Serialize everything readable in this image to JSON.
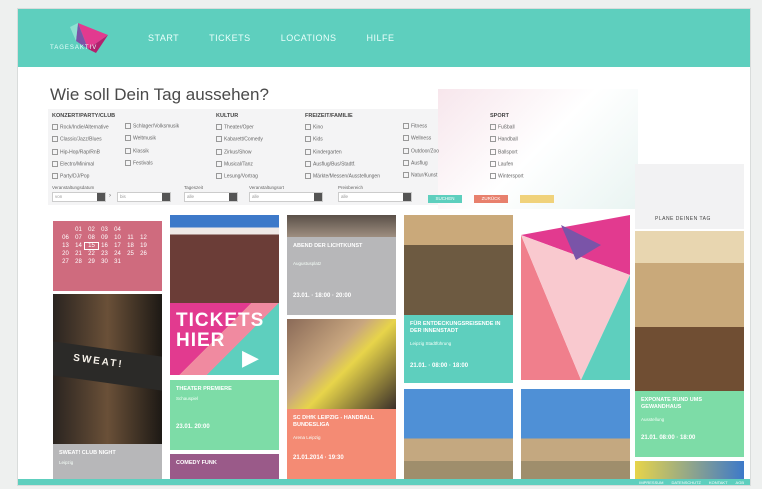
{
  "nav": {
    "items": [
      "START",
      "TICKETS",
      "LOCATIONS",
      "HILFE"
    ]
  },
  "logo": {
    "text": "TAGESAKTIV"
  },
  "headline": "Wie soll Dein Tag aussehen?",
  "filters": [
    {
      "heading": "KONZERT/PARTY/CLUB",
      "items": [
        "Rock/Indie/Alternative",
        "Classic/Jazz/Blues",
        "Hip-Hop/Rap/RnB",
        "Electro/Minimal",
        "Party/DJ/Pop"
      ],
      "col2": [
        "Schlager/Volksmusik",
        "Weltmusik",
        "Klassik",
        "Festivals"
      ]
    },
    {
      "heading": "KULTUR",
      "items": [
        "Theater/Oper",
        "Kabarett/Comedy",
        "Zirkus/Show",
        "Musical/Tanz",
        "Lesung/Vortrag"
      ]
    },
    {
      "heading": "FREIZEIT/FAMILIE",
      "items": [
        "Kino",
        "Kids",
        "Kindergarten",
        "Ausflug/Bus/Stadtf.",
        "Märkte/Messen/Ausstellungen"
      ]
    },
    {
      "heading": "",
      "items": [
        "Fitness",
        "Wellness",
        "Outdoor/Zoo",
        "Ausflug",
        "Natur/Kunst"
      ]
    },
    {
      "heading": "SPORT",
      "items": [
        "Fußball",
        "Handball",
        "Ballsport",
        "Laufen",
        "Wintersport"
      ]
    }
  ],
  "selects": [
    {
      "label": "Veranstaltungsdatum",
      "value": "von"
    },
    {
      "label": "",
      "value": "bis"
    },
    {
      "label": "Tageszeit",
      "value": "alle"
    },
    {
      "label": "Veranstaltungsort",
      "value": "alle"
    },
    {
      "label": "Preisbereich",
      "value": "alle"
    }
  ],
  "buttons": [
    {
      "label": "SUCHEN",
      "color": "#5ecfbe"
    },
    {
      "label": "ZURÜCK",
      "color": "#e8806d"
    },
    {
      "label": "",
      "color": "#f0d27b"
    }
  ],
  "calendar": {
    "rows": [
      [
        "",
        "01",
        "02",
        "03",
        "04",
        "",
        ""
      ],
      [
        "06",
        "07",
        "08",
        "09",
        "10",
        "11",
        "12"
      ],
      [
        "13",
        "14",
        "15",
        "16",
        "17",
        "18",
        "19"
      ],
      [
        "20",
        "21",
        "22",
        "23",
        "24",
        "25",
        "26"
      ],
      [
        "27",
        "28",
        "29",
        "30",
        "31",
        "",
        ""
      ]
    ],
    "today": "15"
  },
  "tiles": {
    "sweat": {
      "title": "SWEAT! CLUB NIGHT",
      "sub": "Leipzig"
    },
    "tickets_hier": {
      "text": "TICKETS HIER"
    },
    "vorverkauf": {
      "title": "THEATER PREMIERE",
      "sub": "Schauspiel",
      "date": "23.01.  20:00"
    },
    "bottom_purple": {
      "title": "COMEDY FUNK"
    },
    "fountain": {
      "title": "ABEND DER LICHTKUNST",
      "sub": "Augustusplatz",
      "date": "23.01. · 18:00 · 20:00"
    },
    "handball": {
      "title": "SC DHfK LEIPZIG - HANDBALL BUNDESLIGA",
      "sub": "Arena Leipzig",
      "date": "21.01.2014 · 19:30"
    },
    "museum": {
      "title": "FÜR ENTDECKUNGSREISENDE IN DER INNENSTADT",
      "sub": "Leipzig Stadtführung",
      "date": "21.01. · 08:00 · 18:00"
    },
    "plaza": {
      "label": "PLANE DEINEN TAG"
    },
    "statue": {
      "title": "EXPONATE RUND UMS GEWANDHAUS",
      "sub": "Ausstellung",
      "date": "21.01. 08:00 · 18:00"
    }
  },
  "footer": {
    "links": [
      "IMPRESSUM",
      "DATENSCHUTZ",
      "KONTAKT",
      "AGB"
    ]
  },
  "colors": {
    "teal": "#5ecfbe",
    "pink": "#cf6b7e",
    "salmon": "#f48b74",
    "green": "#7ddca7",
    "purple": "#9a5a89",
    "grey": "#b7b7b9"
  }
}
